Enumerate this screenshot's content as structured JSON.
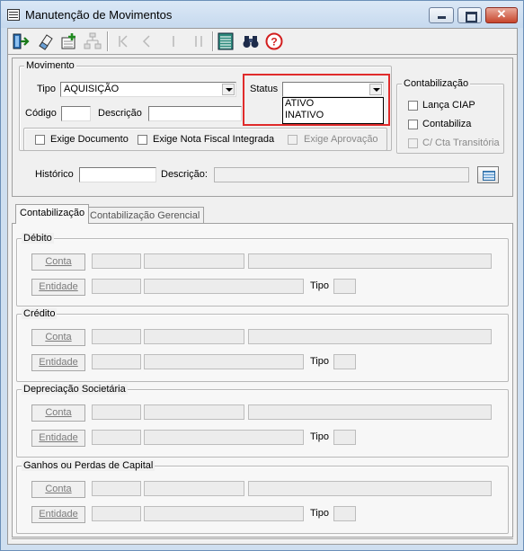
{
  "window": {
    "title": "Manutenção de Movimentos"
  },
  "toolbar": {
    "icons": [
      "exit-icon",
      "eraser-icon",
      "add-record-icon",
      "tree-icon",
      "first-record-icon",
      "previous-record-icon",
      "next-record-icon",
      "last-record-icon",
      "list-icon",
      "binoculars-icon",
      "help-icon"
    ]
  },
  "movimento": {
    "group_title": "Movimento",
    "tipo_label": "Tipo",
    "tipo_value": "AQUISIÇÃO",
    "status_label": "Status",
    "status_value": "",
    "status_options": [
      "ATIVO",
      "INATIVO"
    ],
    "codigo_label": "Código",
    "codigo_value": "",
    "descricao_label": "Descrição",
    "descricao_value": "",
    "exige_documento": "Exige Documento",
    "exige_nota": "Exige Nota Fiscal Integrada",
    "exige_aprovacao": "Exige Aprovação"
  },
  "contabilizacao_group": {
    "title": "Contabilização",
    "lanca_ciap": "Lança CIAP",
    "contabiliza": "Contabiliza",
    "cta_transitoria": "C/ Cta Transitória"
  },
  "historico": {
    "label": "Histórico",
    "value": "",
    "descricao_label": "Descrição:",
    "descricao_value": ""
  },
  "tabs": [
    {
      "label": "Contabilização"
    },
    {
      "label": "Contabilização Gerencial"
    }
  ],
  "sections": [
    {
      "title": "Débito",
      "conta": "Conta",
      "entidade": "Entidade",
      "tipo": "Tipo"
    },
    {
      "title": "Crédito",
      "conta": "Conta",
      "entidade": "Entidade",
      "tipo": "Tipo"
    },
    {
      "title": "Depreciação Societária",
      "conta": "Conta",
      "entidade": "Entidade",
      "tipo": "Tipo"
    },
    {
      "title": "Ganhos ou Perdas de Capital",
      "conta": "Conta",
      "entidade": "Entidade",
      "tipo": "Tipo"
    }
  ],
  "colors": {
    "highlight": "#e02b2b",
    "title_bar": "#cfdff0",
    "close_button": "#c7452c"
  }
}
